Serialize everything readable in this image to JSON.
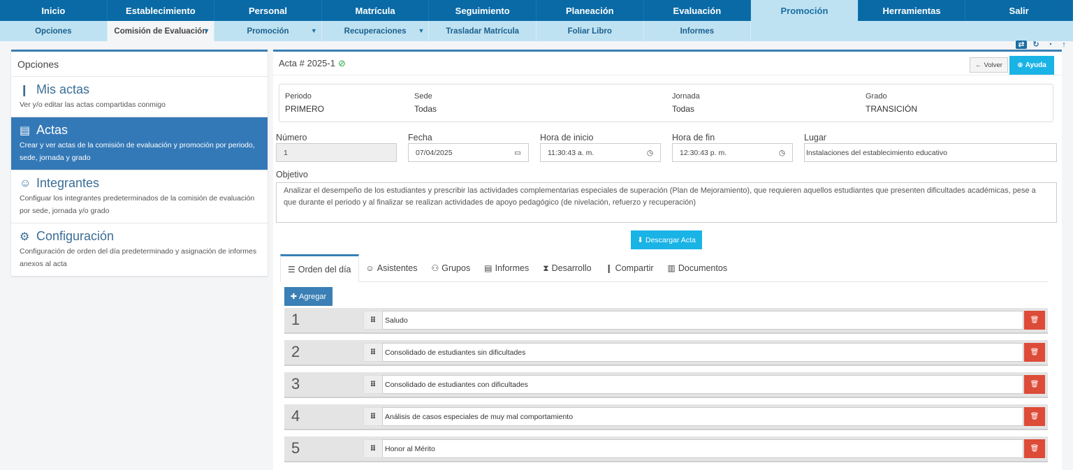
{
  "topnav": [
    "Inicio",
    "Establecimiento",
    "Personal",
    "Matrícula",
    "Seguimiento",
    "Planeación",
    "Evaluación",
    "Promoción",
    "Herramientas",
    "Salir"
  ],
  "topnav_active": "Promoción",
  "subnav": [
    {
      "label": "Opciones",
      "caret": false
    },
    {
      "label": "Comisión de Evaluación",
      "caret": true,
      "active": true
    },
    {
      "label": "Promoción",
      "caret": true
    },
    {
      "label": "Recuperaciones",
      "caret": true
    },
    {
      "label": "Trasladar Matrícula",
      "caret": false
    },
    {
      "label": "Foliar Libro",
      "caret": false
    },
    {
      "label": "Informes",
      "caret": false
    }
  ],
  "left": {
    "heading": "Opciones",
    "options": [
      {
        "icon": "share-icon",
        "glyph": "❙",
        "title": "Mis actas",
        "desc": "Ver y/o editar las actas compartidas conmigo"
      },
      {
        "icon": "book-icon",
        "glyph": "▤",
        "title": "Actas",
        "desc": "Crear y ver actas de la comisión de evaluación y promoción por periodo, sede, jornada y grado",
        "active": true
      },
      {
        "icon": "user-plus-icon",
        "glyph": "☺",
        "title": "Integrantes",
        "desc": "Configuar los integrantes predeterminados de la comisión de evaluación por sede, jornada y/o grado"
      },
      {
        "icon": "gears-icon",
        "glyph": "⚙",
        "title": "Configuración",
        "desc": "Configuración de orden del día predeterminado y asignación de informes anexos al acta"
      }
    ]
  },
  "acta": {
    "title": "Acta # 2025-1",
    "volver": "Volver",
    "ayuda": "Ayuda",
    "info": [
      {
        "label": "Periodo",
        "value": "PRIMERO"
      },
      {
        "label": "Sede",
        "value": "Todas"
      },
      {
        "label": "Jornada",
        "value": "Todas"
      },
      {
        "label": "Grado",
        "value": "TRANSICIÓN"
      }
    ],
    "numero_label": "Número",
    "numero": "1",
    "fecha_label": "Fecha",
    "fecha": "07/04/2025",
    "hora_inicio_label": "Hora de inicio",
    "hora_inicio": "11:30:43 a. m.",
    "hora_fin_label": "Hora de fin",
    "hora_fin": "12:30:43 p. m.",
    "lugar_label": "Lugar",
    "lugar": "Instalaciones del establecimiento educativo",
    "objetivo_label": "Objetivo",
    "objetivo": "Analizar el desempeño de los estudiantes y prescribir las actividades complementarias especiales de superación (Plan de Mejoramiento), que requieren aquellos estudiantes que presenten dificultades académicas, pese a que durante el periodo y al finalizar se realizan actividades de apoyo pedagógico (de nivelación, refuerzo y recuperación)",
    "descargar": "Descargar Acta"
  },
  "tabs": [
    {
      "label": "Orden del día",
      "icon": "list-icon",
      "glyph": "☰",
      "active": true
    },
    {
      "label": "Asistentes",
      "icon": "user-plus-icon",
      "glyph": "☺"
    },
    {
      "label": "Grupos",
      "icon": "users-icon",
      "glyph": "⚇"
    },
    {
      "label": "Informes",
      "icon": "file-icon",
      "glyph": "▤"
    },
    {
      "label": "Desarrollo",
      "icon": "hourglass-icon",
      "glyph": "⧗"
    },
    {
      "label": "Compartir",
      "icon": "share-icon",
      "glyph": "❙"
    },
    {
      "label": "Documentos",
      "icon": "book-icon",
      "glyph": "▥"
    }
  ],
  "agregar": "Agregar",
  "agenda": [
    {
      "n": "1",
      "text": "Saludo"
    },
    {
      "n": "2",
      "text": "Consolidado de estudiantes sin dificultades"
    },
    {
      "n": "3",
      "text": "Consolidado de estudiantes con dificultades"
    },
    {
      "n": "4",
      "text": "Análisis de casos especiales de muy mal comportamiento"
    },
    {
      "n": "5",
      "text": "Honor al Mérito"
    }
  ],
  "colors": {
    "primary": "#0a6aa5",
    "accent": "#1ab3e6",
    "danger": "#dd4b39",
    "success": "#28a745"
  }
}
